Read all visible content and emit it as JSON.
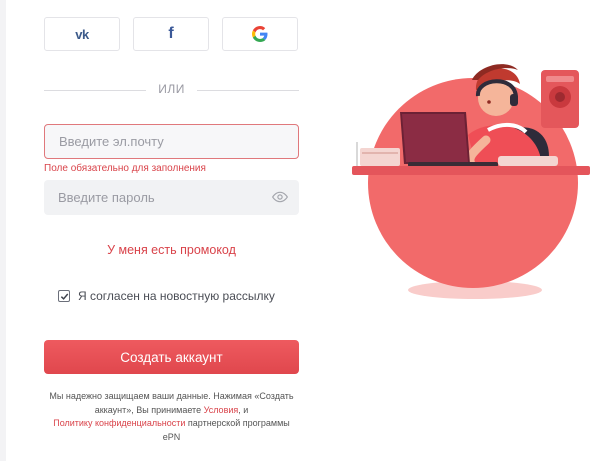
{
  "social": {
    "vk_label": "vk",
    "facebook_label": "f",
    "google_label": "G"
  },
  "divider": {
    "text": "ИЛИ"
  },
  "email": {
    "placeholder": "Введите эл.почту",
    "value": "",
    "error": "Поле обязательно для заполнения"
  },
  "password": {
    "placeholder": "Введите пароль",
    "value": ""
  },
  "promo": {
    "label": "У меня есть промокод"
  },
  "newsletter": {
    "label": "Я согласен на новостную рассылку",
    "checked": true
  },
  "submit": {
    "label": "Создать аккаунт"
  },
  "legal": {
    "text1": "Мы надежно защищаем ваши данные. Нажимая «Создать аккаунт», Вы принимаете ",
    "terms_link": "Условия",
    "text2": ", и ",
    "privacy_link": "Политику конфиденциальности",
    "text3": " партнерской программы ePN"
  },
  "colors": {
    "accent": "#e0474d",
    "error_border": "#e0787c",
    "illustration_circle": "#f26a6a",
    "vk": "#3c5a8a",
    "facebook": "#3b5998"
  },
  "icons": [
    "vk-icon",
    "facebook-icon",
    "google-icon",
    "eye-icon",
    "checkmark-icon"
  ]
}
